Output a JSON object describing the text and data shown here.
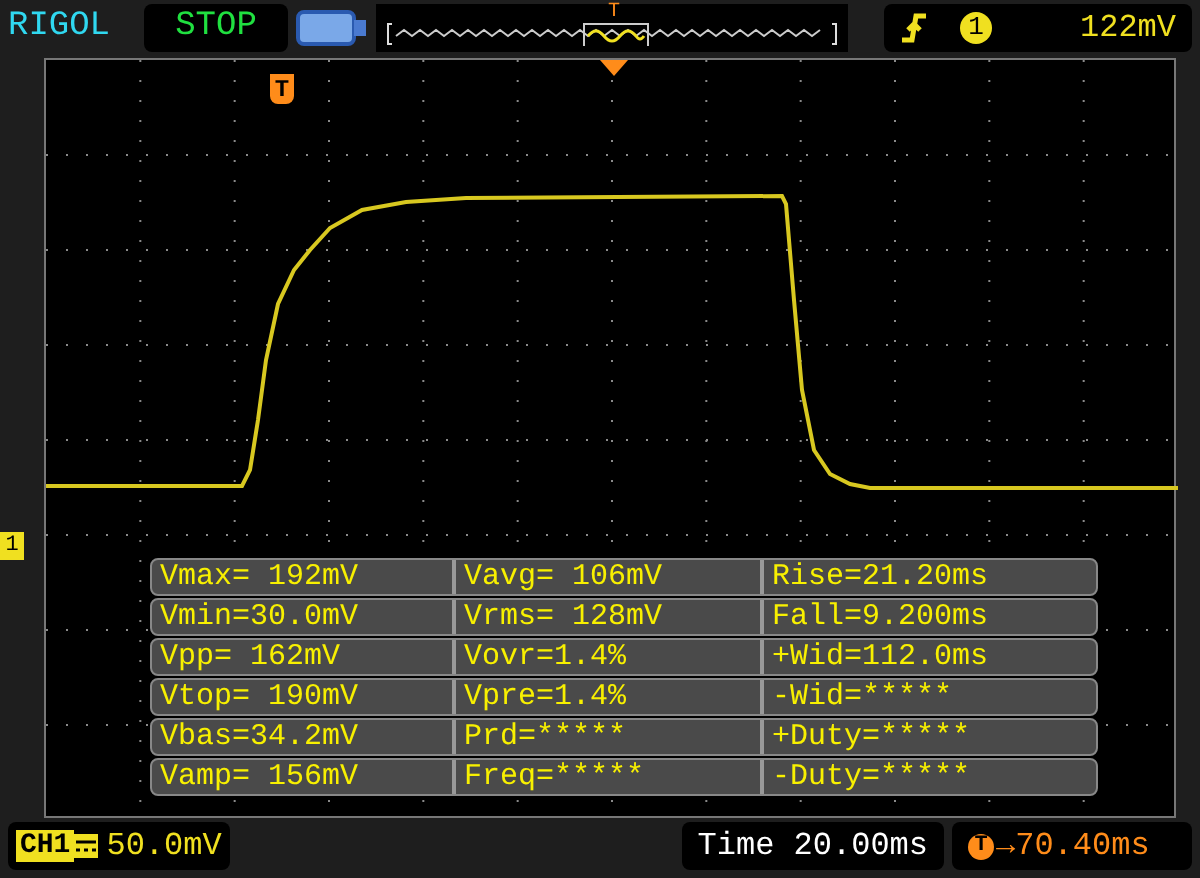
{
  "header": {
    "brand": "RIGOL",
    "run_state": "STOP",
    "memory_trigger_marker": "T",
    "trigger": {
      "channel": "1",
      "level": "122mV"
    }
  },
  "screen": {
    "trigger_marker": "T",
    "channel_marker": "1"
  },
  "measurements": [
    [
      "Vmax= 192mV",
      "Vavg= 106mV",
      "Rise=21.20ms"
    ],
    [
      "Vmin=30.0mV",
      "Vrms= 128mV",
      "Fall=9.200ms"
    ],
    [
      "Vpp= 162mV",
      "Vovr=1.4%",
      "+Wid=112.0ms"
    ],
    [
      "Vtop= 190mV",
      "Vpre=1.4%",
      "-Wid=*****"
    ],
    [
      "Vbas=34.2mV",
      "Prd=*****",
      "+Duty=*****"
    ],
    [
      "Vamp= 156mV",
      "Freq=*****",
      "-Duty=*****"
    ]
  ],
  "footer": {
    "channel": "CH1",
    "scale": "50.0mV",
    "timebase": "Time 20.00ms",
    "offset_icon": "T",
    "offset": "→70.40ms"
  }
}
